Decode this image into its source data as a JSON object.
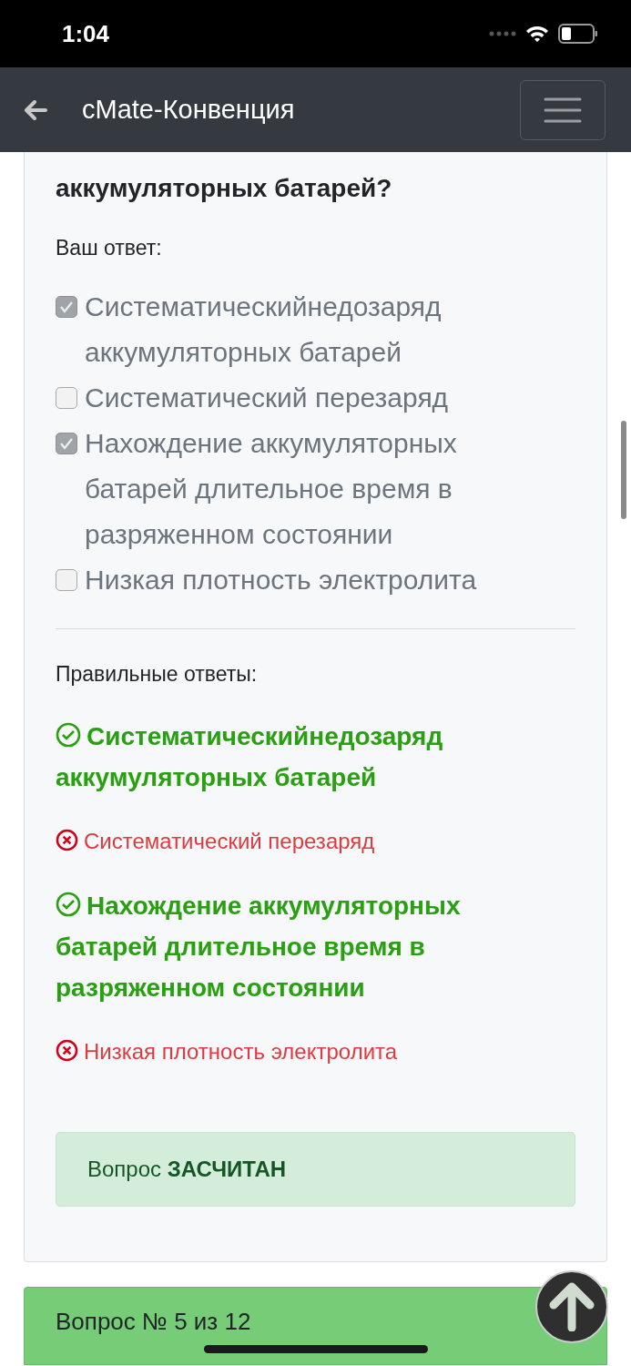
{
  "status_bar": {
    "time": "1:04"
  },
  "navbar": {
    "title": "cMate-Конвенция"
  },
  "question": {
    "lines": [
      "аккумуляторных батарей?"
    ]
  },
  "answer_label": "Ваш ответ:",
  "options": [
    {
      "label": "Систематическийнедозаряд аккумуляторных батарей",
      "checked": true
    },
    {
      "label": "Систематический перезаряд",
      "checked": false
    },
    {
      "label": "Нахождение аккумуляторных батарей длительное время в разряженном состоянии",
      "checked": true
    },
    {
      "label": "Низкая плотность электролита",
      "checked": false
    }
  ],
  "correct_label": "Правильные ответы:",
  "results": [
    {
      "label": "Систематическийнедозаряд аккумуляторных батарей",
      "correct": true
    },
    {
      "label": "Систематический перезаряд",
      "correct": false
    },
    {
      "label": "Нахождение аккумуляторных батарей длительное время в разряженном состоянии",
      "correct": true
    },
    {
      "label": "Низкая плотность электролита",
      "correct": false
    }
  ],
  "verdict": "Вопрос **ЗАСЧИТАН**",
  "next_question": {
    "title": "Вопрос № 5 из 12"
  }
}
